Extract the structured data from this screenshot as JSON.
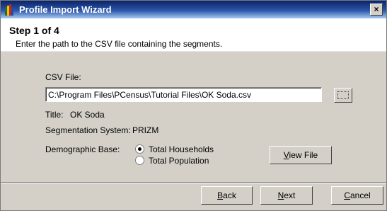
{
  "window": {
    "title": "Profile Import Wizard",
    "close_glyph": "×"
  },
  "header": {
    "step": "Step 1 of 4",
    "instruction": "Enter the path to the CSV file containing the segments."
  },
  "form": {
    "csv_label": "CSV File:",
    "csv_path": "C:\\Program Files\\PCensus\\Tutorial Files\\OK Soda.csv",
    "title_label": "Title:",
    "title_value": "OK Soda",
    "seg_label": "Segmentation System:",
    "seg_value": "PRIZM",
    "demo_label": "Demographic Base:",
    "demo_options": [
      {
        "label": "Total Households",
        "selected": true
      },
      {
        "label": "Total Population",
        "selected": false
      }
    ],
    "view_file": {
      "mnemonic": "V",
      "rest": "iew File"
    }
  },
  "footer": {
    "back": {
      "mnemonic": "B",
      "rest": "ack"
    },
    "next": {
      "mnemonic": "N",
      "rest": "ext"
    },
    "cancel": {
      "mnemonic": "C",
      "rest": "ancel"
    }
  },
  "icons": {
    "app": "wizard-app-icon",
    "close": "close-icon",
    "browse": "browse-icon"
  }
}
